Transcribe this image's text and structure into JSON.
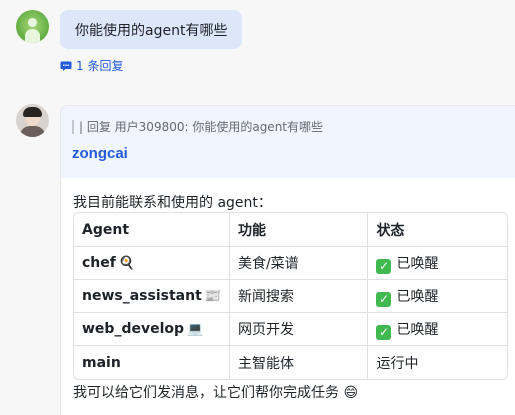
{
  "message1": {
    "text": "你能使用的agent有哪些",
    "reply_count": "1 条回复"
  },
  "message2": {
    "quote": "| 回复 用户309800:  你能使用的agent有哪些",
    "sender": "zongcai",
    "intro": "我目前能联系和使用的 agent：",
    "table": {
      "headers": [
        "Agent",
        "功能",
        "状态"
      ],
      "rows": [
        {
          "agent": "chef",
          "icon": "🍳",
          "function": "美食/菜谱",
          "status": "已唤醒",
          "status_icon": "✓"
        },
        {
          "agent": "news_assistant",
          "icon": "📰",
          "function": "新闻搜索",
          "status": "已唤醒",
          "status_icon": "✓"
        },
        {
          "agent": "web_develop",
          "icon": "💻",
          "function": "网页开发",
          "status": "已唤醒",
          "status_icon": "✓"
        },
        {
          "agent": "main",
          "icon": "",
          "function": "主智能体",
          "status": "运行中",
          "status_icon": ""
        }
      ]
    },
    "outro": "我可以给它们发消息，让它们帮你完成任务 😄"
  },
  "colors": {
    "accent": "#245bdb",
    "bubble": "#dde7fb",
    "quote_bg": "#f1f5fe",
    "check": "#3fb950"
  },
  "icons": {
    "reply": "comment-icon",
    "avatar1": "user-avatar-green",
    "avatar2": "user-avatar-photo"
  }
}
